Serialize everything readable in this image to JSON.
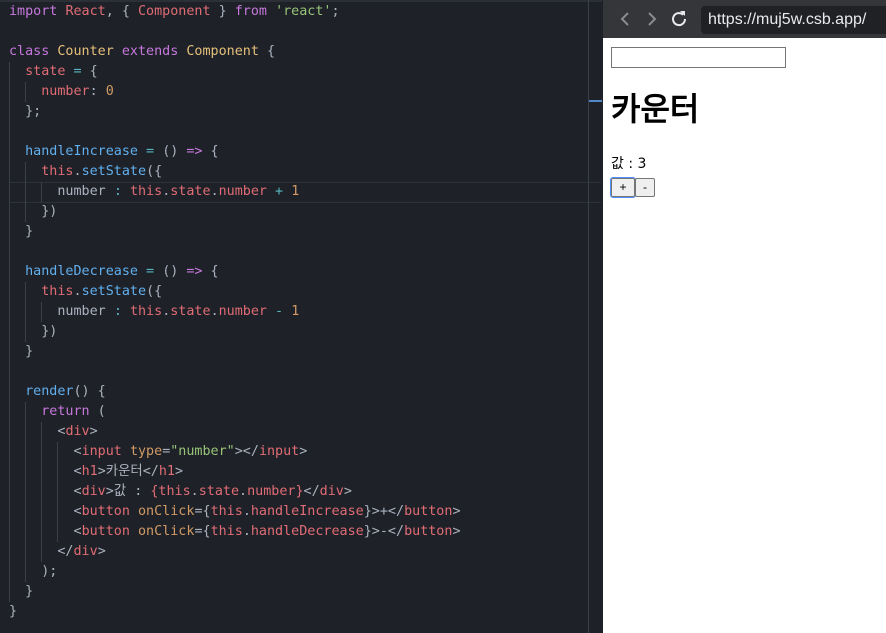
{
  "browser": {
    "url": "https://muj5w.csb.app/",
    "page": {
      "heading": "카운터",
      "value_label": "값 : 3",
      "input_value": "",
      "plus_label": "+",
      "minus_label": "-"
    }
  },
  "editor": {
    "lines": [
      [
        {
          "c": "k",
          "t": "import "
        },
        {
          "c": "t",
          "t": "React"
        },
        {
          "c": "p",
          "t": ", { "
        },
        {
          "c": "t",
          "t": "Component"
        },
        {
          "c": "p",
          "t": " } "
        },
        {
          "c": "k",
          "t": "from "
        },
        {
          "c": "s",
          "t": "'react'"
        },
        {
          "c": "p",
          "t": ";"
        }
      ],
      [],
      [
        {
          "c": "k",
          "t": "class "
        },
        {
          "c": "c",
          "t": "Counter "
        },
        {
          "c": "k",
          "t": "extends "
        },
        {
          "c": "c",
          "t": "Component"
        },
        {
          "c": "p",
          "t": " {"
        }
      ],
      [
        {
          "c": "p",
          "t": "  "
        },
        {
          "c": "t",
          "t": "state"
        },
        {
          "c": "o",
          "t": " = "
        },
        {
          "c": "p",
          "t": "{"
        }
      ],
      [
        {
          "c": "p",
          "t": "    "
        },
        {
          "c": "t",
          "t": "number"
        },
        {
          "c": "p",
          "t": ": "
        },
        {
          "c": "num",
          "t": "0"
        }
      ],
      [
        {
          "c": "p",
          "t": "  };"
        }
      ],
      [],
      [
        {
          "c": "p",
          "t": "  "
        },
        {
          "c": "f",
          "t": "handleIncrease"
        },
        {
          "c": "o",
          "t": " = "
        },
        {
          "c": "p",
          "t": "() "
        },
        {
          "c": "k",
          "t": "=>"
        },
        {
          "c": "p",
          "t": " {"
        }
      ],
      [
        {
          "c": "p",
          "t": "    "
        },
        {
          "c": "t",
          "t": "this"
        },
        {
          "c": "p",
          "t": "."
        },
        {
          "c": "f",
          "t": "setState"
        },
        {
          "c": "p",
          "t": "({"
        }
      ],
      [
        {
          "c": "p",
          "t": "      number "
        },
        {
          "c": "o",
          "t": ": "
        },
        {
          "c": "t",
          "t": "this"
        },
        {
          "c": "p",
          "t": "."
        },
        {
          "c": "t",
          "t": "state"
        },
        {
          "c": "p",
          "t": "."
        },
        {
          "c": "t",
          "t": "number"
        },
        {
          "c": "o",
          "t": " + "
        },
        {
          "c": "num",
          "t": "1"
        }
      ],
      [
        {
          "c": "p",
          "t": "    })"
        }
      ],
      [
        {
          "c": "p",
          "t": "  }"
        }
      ],
      [],
      [
        {
          "c": "p",
          "t": "  "
        },
        {
          "c": "f",
          "t": "handleDecrease"
        },
        {
          "c": "o",
          "t": " = "
        },
        {
          "c": "p",
          "t": "() "
        },
        {
          "c": "k",
          "t": "=>"
        },
        {
          "c": "p",
          "t": " {"
        }
      ],
      [
        {
          "c": "p",
          "t": "    "
        },
        {
          "c": "t",
          "t": "this"
        },
        {
          "c": "p",
          "t": "."
        },
        {
          "c": "f",
          "t": "setState"
        },
        {
          "c": "p",
          "t": "({"
        }
      ],
      [
        {
          "c": "p",
          "t": "      number "
        },
        {
          "c": "o",
          "t": ": "
        },
        {
          "c": "t",
          "t": "this"
        },
        {
          "c": "p",
          "t": "."
        },
        {
          "c": "t",
          "t": "state"
        },
        {
          "c": "p",
          "t": "."
        },
        {
          "c": "t",
          "t": "number"
        },
        {
          "c": "o",
          "t": " - "
        },
        {
          "c": "num",
          "t": "1"
        }
      ],
      [
        {
          "c": "p",
          "t": "    })"
        }
      ],
      [
        {
          "c": "p",
          "t": "  }"
        }
      ],
      [],
      [
        {
          "c": "p",
          "t": "  "
        },
        {
          "c": "f",
          "t": "render"
        },
        {
          "c": "p",
          "t": "() {"
        }
      ],
      [
        {
          "c": "p",
          "t": "    "
        },
        {
          "c": "k",
          "t": "return"
        },
        {
          "c": "p",
          "t": " ("
        }
      ],
      [
        {
          "c": "p",
          "t": "      <"
        },
        {
          "c": "t",
          "t": "div"
        },
        {
          "c": "p",
          "t": ">"
        }
      ],
      [
        {
          "c": "p",
          "t": "        <"
        },
        {
          "c": "t",
          "t": "input "
        },
        {
          "c": "a",
          "t": "type"
        },
        {
          "c": "p",
          "t": "="
        },
        {
          "c": "s",
          "t": "\"number\""
        },
        {
          "c": "p",
          "t": "></"
        },
        {
          "c": "t",
          "t": "input"
        },
        {
          "c": "p",
          "t": ">"
        }
      ],
      [
        {
          "c": "p",
          "t": "        <"
        },
        {
          "c": "t",
          "t": "h1"
        },
        {
          "c": "p",
          "t": ">카운터</"
        },
        {
          "c": "t",
          "t": "h1"
        },
        {
          "c": "p",
          "t": ">"
        }
      ],
      [
        {
          "c": "p",
          "t": "        <"
        },
        {
          "c": "t",
          "t": "div"
        },
        {
          "c": "p",
          "t": ">값 : "
        },
        {
          "c": "t",
          "t": "{"
        },
        {
          "c": "t",
          "t": "this"
        },
        {
          "c": "p",
          "t": "."
        },
        {
          "c": "t",
          "t": "state"
        },
        {
          "c": "p",
          "t": "."
        },
        {
          "c": "t",
          "t": "number"
        },
        {
          "c": "t",
          "t": "}"
        },
        {
          "c": "p",
          "t": "</"
        },
        {
          "c": "t",
          "t": "div"
        },
        {
          "c": "p",
          "t": ">"
        }
      ],
      [
        {
          "c": "p",
          "t": "        <"
        },
        {
          "c": "t",
          "t": "button "
        },
        {
          "c": "a",
          "t": "onClick"
        },
        {
          "c": "p",
          "t": "={"
        },
        {
          "c": "t",
          "t": "this"
        },
        {
          "c": "p",
          "t": "."
        },
        {
          "c": "t",
          "t": "handleIncrease"
        },
        {
          "c": "p",
          "t": "}>+</"
        },
        {
          "c": "t",
          "t": "button"
        },
        {
          "c": "p",
          "t": ">"
        }
      ],
      [
        {
          "c": "p",
          "t": "        <"
        },
        {
          "c": "t",
          "t": "button "
        },
        {
          "c": "a",
          "t": "onClick"
        },
        {
          "c": "p",
          "t": "={"
        },
        {
          "c": "t",
          "t": "this"
        },
        {
          "c": "p",
          "t": "."
        },
        {
          "c": "t",
          "t": "handleDecrease"
        },
        {
          "c": "p",
          "t": "}>-</"
        },
        {
          "c": "t",
          "t": "button"
        },
        {
          "c": "p",
          "t": ">"
        }
      ],
      [
        {
          "c": "p",
          "t": "      </"
        },
        {
          "c": "t",
          "t": "div"
        },
        {
          "c": "p",
          "t": ">"
        }
      ],
      [
        {
          "c": "p",
          "t": "    );"
        }
      ],
      [
        {
          "c": "p",
          "t": "  }"
        }
      ],
      [
        {
          "c": "p",
          "t": "}"
        }
      ]
    ]
  }
}
